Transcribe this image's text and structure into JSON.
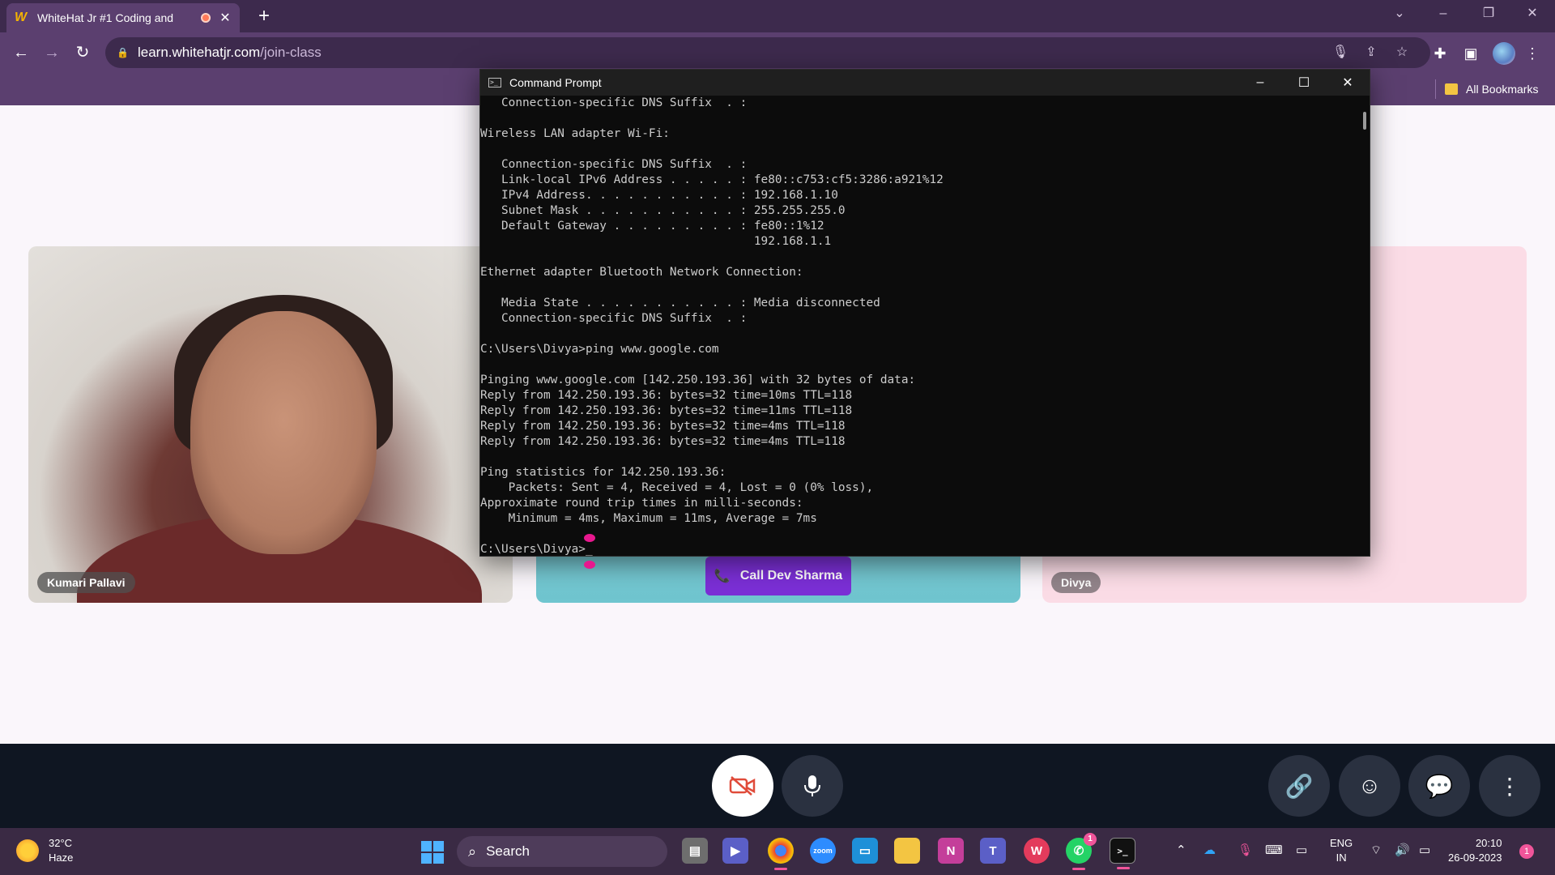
{
  "browser": {
    "tab_title": "WhiteHat Jr #1 Coding and",
    "tab_favicon": "W",
    "new_tab_label": "+",
    "url_host": "learn.whitehatjr.com",
    "url_path": "/join-class",
    "bookmarks_label": "All Bookmarks",
    "window_controls": [
      "⌄",
      "–",
      "❐",
      "✕"
    ]
  },
  "page": {
    "participants": [
      {
        "name": "Kumari Pallavi"
      },
      {
        "name": "Divya"
      }
    ],
    "call_button_label": "Call Dev Sharma"
  },
  "cmd": {
    "title": "Command Prompt",
    "lines": [
      "   Connection-specific DNS Suffix  . :",
      "",
      "Wireless LAN adapter Wi-Fi:",
      "",
      "   Connection-specific DNS Suffix  . :",
      "   Link-local IPv6 Address . . . . . : fe80::c753:cf5:3286:a921%12",
      "   IPv4 Address. . . . . . . . . . . : 192.168.1.10",
      "   Subnet Mask . . . . . . . . . . . : 255.255.255.0",
      "   Default Gateway . . . . . . . . . : fe80::1%12",
      "                                       192.168.1.1",
      "",
      "Ethernet adapter Bluetooth Network Connection:",
      "",
      "   Media State . . . . . . . . . . . : Media disconnected",
      "   Connection-specific DNS Suffix  . :",
      "",
      "C:\\Users\\Divya>ping www.google.com",
      "",
      "Pinging www.google.com [142.250.193.36] with 32 bytes of data:",
      "Reply from 142.250.193.36: bytes=32 time=10ms TTL=118",
      "Reply from 142.250.193.36: bytes=32 time=11ms TTL=118",
      "Reply from 142.250.193.36: bytes=32 time=4ms TTL=118",
      "Reply from 142.250.193.36: bytes=32 time=4ms TTL=118",
      "",
      "Ping statistics for 142.250.193.36:",
      "    Packets: Sent = 4, Received = 4, Lost = 0 (0% loss),",
      "Approximate round trip times in milli-seconds:",
      "    Minimum = 4ms, Maximum = 11ms, Average = 7ms",
      "",
      "C:\\Users\\Divya>_"
    ]
  },
  "taskbar": {
    "temperature": "32°C",
    "weather": "Haze",
    "search_label": "Search",
    "lang_top": "ENG",
    "lang_bottom": "IN",
    "time": "20:10",
    "date": "26-09-2023",
    "whatsapp_badge": "1",
    "notification_count": "1"
  },
  "colors": {
    "browser_frame": "#5b3f6f",
    "call_button": "#7b2fd6",
    "control_bar": "#0f1622",
    "taskbar": "#3a2a44"
  }
}
